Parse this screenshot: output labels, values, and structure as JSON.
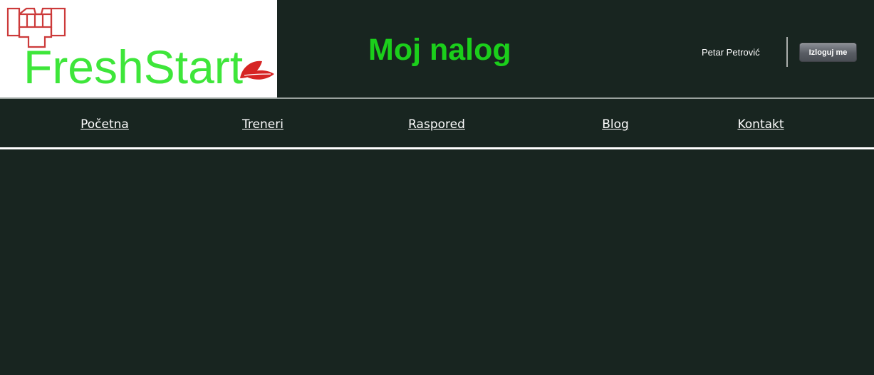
{
  "header": {
    "logo_text": "FreshStart",
    "title": "Moj nalog",
    "user_name": "Petar Petrović",
    "logout_label": "Izloguj me"
  },
  "nav": {
    "items": [
      {
        "label": "Početna"
      },
      {
        "label": "Treneri"
      },
      {
        "label": "Raspored"
      },
      {
        "label": "Blog"
      },
      {
        "label": "Kontakt"
      }
    ]
  },
  "colors": {
    "background": "#182520",
    "title": "#1bcf1b",
    "logo_green": "#3ee63a",
    "logo_red": "#cc2b2b"
  },
  "icons": {
    "logo_icon": "fist-icon",
    "logo_leaf": "leaf-icon"
  }
}
